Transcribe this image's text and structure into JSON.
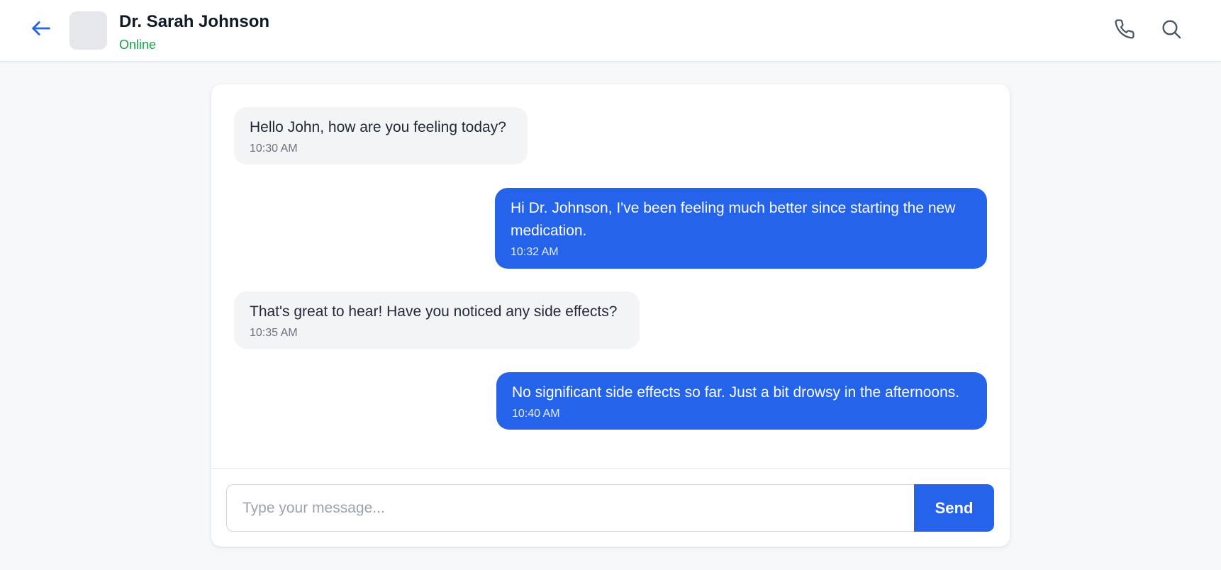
{
  "header": {
    "contact_name": "Dr. Sarah Johnson",
    "status": "Online",
    "back_icon": "arrow-left-icon",
    "actions": [
      "phone-icon",
      "search-icon"
    ]
  },
  "messages": [
    {
      "direction": "incoming",
      "text": "Hello John, how are you feeling today?",
      "time": "10:30 AM"
    },
    {
      "direction": "outgoing",
      "text": "Hi Dr. Johnson, I've been feeling much better since starting the new medication.",
      "time": "10:32 AM"
    },
    {
      "direction": "incoming",
      "text": "That's great to hear! Have you noticed any side effects?",
      "time": "10:35 AM"
    },
    {
      "direction": "outgoing",
      "text": "No significant side effects so far. Just a bit drowsy in the afternoons.",
      "time": "10:40 AM"
    }
  ],
  "composer": {
    "placeholder": "Type your message...",
    "value": "",
    "send_label": "Send"
  },
  "colors": {
    "accent": "#2563eb",
    "online": "#16a34a",
    "incoming_bubble": "#f3f4f6",
    "page_bg": "#f7f8fa"
  }
}
